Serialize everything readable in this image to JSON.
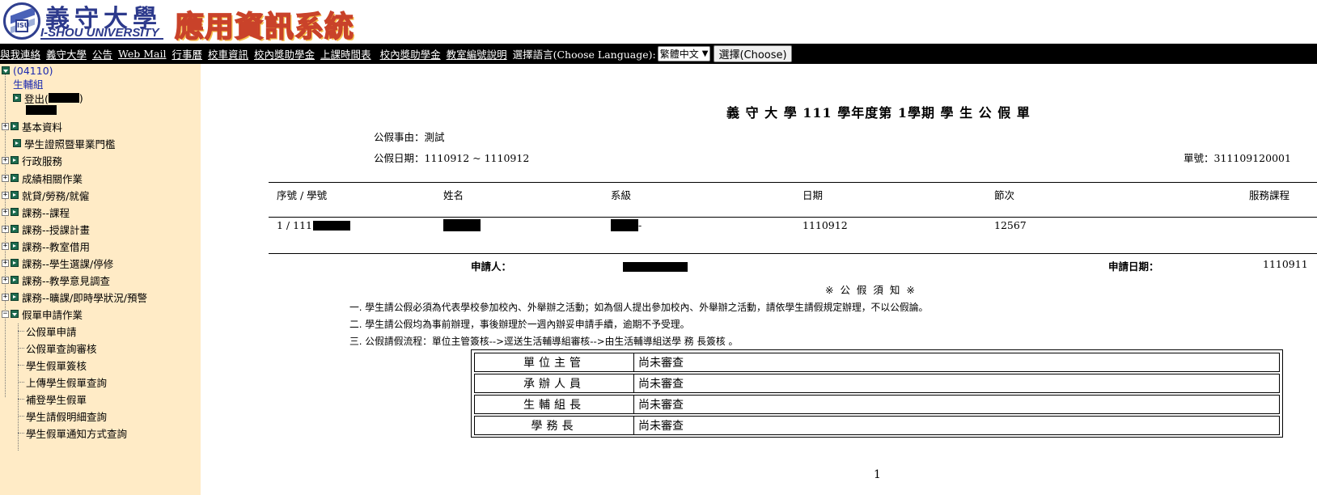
{
  "header": {
    "university_cn": "義守大學",
    "university_en": "I-SHOU UNIVERSITY",
    "system_title": "應用資訊系統"
  },
  "nav": {
    "links": [
      "與我連絡",
      "義守大學",
      "公告",
      "Web Mail",
      "行事曆",
      "校車資訊",
      "校內獎助學金",
      "上課時間表",
      "校內獎助學金",
      "教室編號說明"
    ],
    "language_label": "選擇語言(Choose Language):",
    "language_selected": "繁體中文",
    "choose_button": "選擇(Choose)"
  },
  "sidebar": {
    "root_code": "(04110)",
    "root_group": "生輔組",
    "logout_prefix": "登出(",
    "logout_suffix": ")",
    "items": [
      {
        "label": "基本資料",
        "expanded": false
      },
      {
        "label": "學生證照暨畢業門檻",
        "expanded": false,
        "leaf": true
      },
      {
        "label": "行政服務",
        "expanded": false
      },
      {
        "label": "成績相關作業",
        "expanded": false
      },
      {
        "label": "就貸/勞務/就僱",
        "expanded": false
      },
      {
        "label": "課務--課程",
        "expanded": false
      },
      {
        "label": "課務--授課計畫",
        "expanded": false
      },
      {
        "label": "課務--教室借用",
        "expanded": false
      },
      {
        "label": "課務--學生選課/停修",
        "expanded": false
      },
      {
        "label": "課務--教學意見調查",
        "expanded": false
      },
      {
        "label": "課務--曠課/即時學狀況/預警",
        "expanded": false
      },
      {
        "label": "假單申請作業",
        "expanded": true
      }
    ],
    "sub_items": [
      "公假單申請",
      "公假單查詢審核",
      "學生假單簽核",
      "上傳學生假單查詢",
      "補登學生假單",
      "學生請假明細查詢",
      "學生假單通知方式查詢"
    ]
  },
  "form": {
    "title": "義 守 大 學 111 學年度第  1學期 學 生 公 假 單",
    "reason_label": "公假事由：",
    "reason_value": "測試",
    "date_label": "公假日期：",
    "date_value": "1110912 ~  1110912",
    "number_label": "單號：",
    "number_value": "311109120001",
    "columns": [
      "序號 / 學號",
      "姓名",
      "系級",
      "日期",
      "節次",
      "服務課程"
    ],
    "row": {
      "seq_prefix": "1 / 111",
      "date": "1110912",
      "periods": "12567",
      "class_suffix": "-"
    },
    "applicant_label": "申請人：",
    "apply_date_label": "申請日期：",
    "apply_date_value": "1110911",
    "notice_title": "※ 公 假 須 知 ※",
    "notices": [
      "一. 學生請公假必須為代表學校參加校內、外舉辦之活動；如為個人提出參加校內、外舉辦之活動，請依學生請假規定辦理，不以公假論。",
      "二. 學生請公假均為事前辦理，事後辦理於一週內辦妥申請手續，逾期不予受理。",
      "三. 公假請假流程：單位主管簽核-->逕送生活輔導組審核-->由生活輔導組送學 務 長簽核 。"
    ],
    "approvals": [
      {
        "role": "單位主管",
        "status": "尚未審查"
      },
      {
        "role": "承辦人員",
        "status": "尚未審查"
      },
      {
        "role": "生輔組長",
        "status": "尚未審查"
      },
      {
        "role": "學務長",
        "status": "尚未審查"
      }
    ],
    "page_number": "1"
  }
}
